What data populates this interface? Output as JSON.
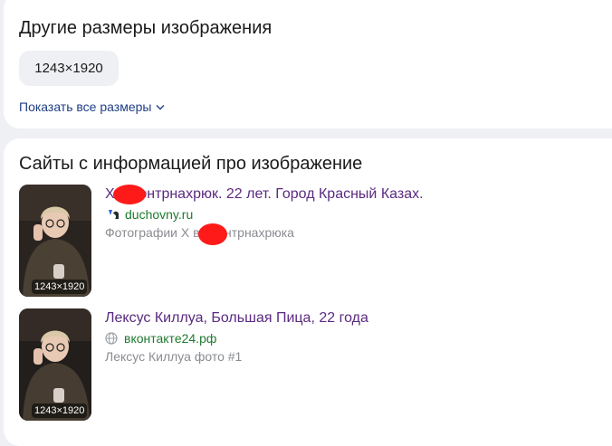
{
  "other_sizes": {
    "heading": "Другие размеры изображения",
    "chip": "1243×1920",
    "show_all": "Показать все размеры",
    "show_all_icon": "chevron-down-icon"
  },
  "sites": {
    "heading": "Сайты с информацией про изображение",
    "results": [
      {
        "title": "Х      в Контрнахрюк. 22 лет. Город Красный Казах.",
        "site": "duchovny.ru",
        "favicon": "vk-favicon-icon",
        "description": "Фотографии Х       ва Контрнахрюка",
        "size": "1243×1920"
      },
      {
        "title": "Лексус Киллуа, Большая Пица, 22 года",
        "site": "вконтакте24.рф",
        "favicon": "globe-icon",
        "description": "Лексус Киллуа фото #1",
        "size": "1243×1920"
      }
    ]
  },
  "colors": {
    "link_visited": "#5a2a80",
    "site_green": "#1e7a2e",
    "muted": "#8a8c92",
    "redaction": "#ff1a1a"
  }
}
